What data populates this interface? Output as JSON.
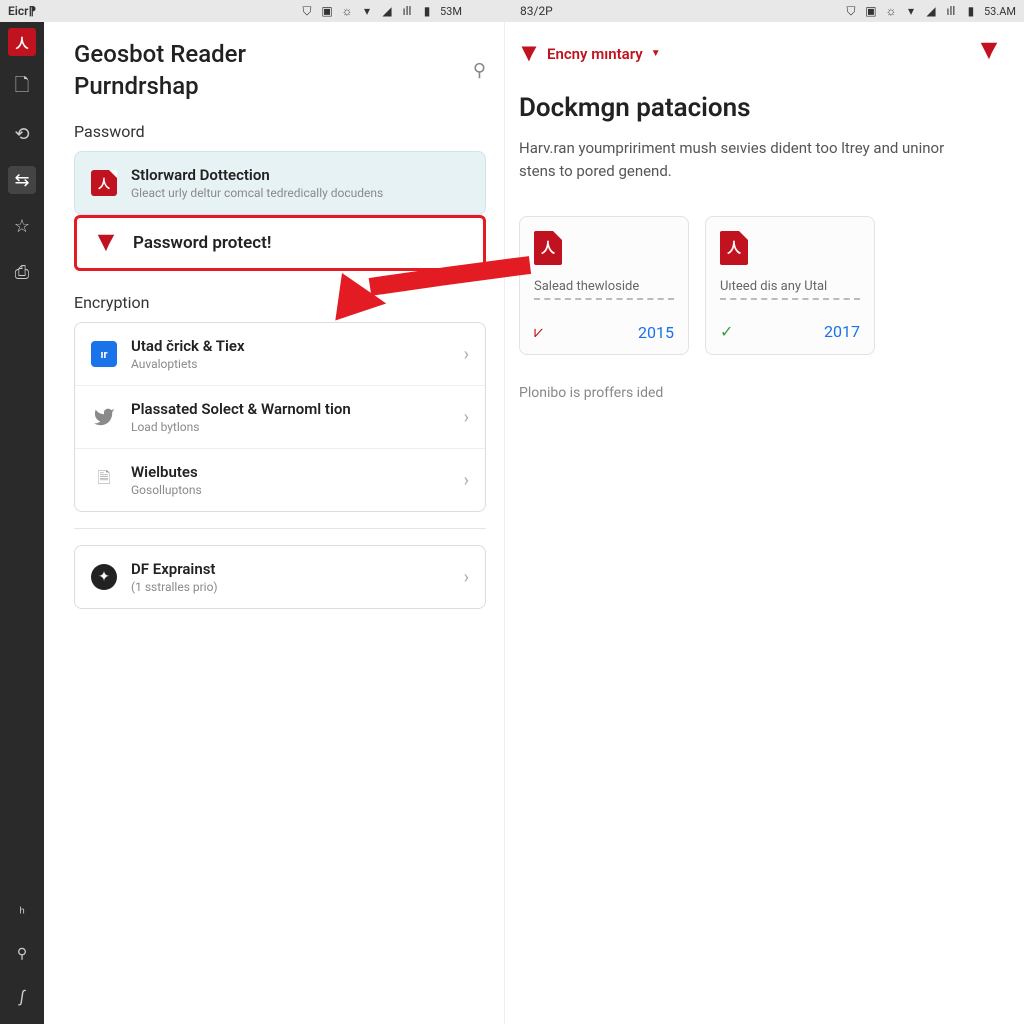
{
  "statusbar": {
    "left_label": "Eicr⁋",
    "time1": "53M",
    "time_mid": "83/2P",
    "time2": "53.AM"
  },
  "left": {
    "title": "Geosbot Reader",
    "subtitle": "Purndrshap",
    "section_password": "Password",
    "card1": {
      "title": "Stlorward Dottection",
      "sub": "Gleact urly deltur comcal tedredically docudens"
    },
    "highlight": {
      "title": "Password protect!"
    },
    "section_encryption": "Encryption",
    "enc1": {
      "title": "Utad črick & Tiex",
      "sub": "Auvaloptiets"
    },
    "enc2": {
      "title": "Plassated Solect & Warnoml tion",
      "sub": "Load bytlons"
    },
    "enc3": {
      "title": "Wielbutes",
      "sub": "Gosolluptons"
    },
    "extra": {
      "title": "DF Exprainst",
      "sub": "(1 sstralles prio)"
    }
  },
  "right": {
    "brand": "Encny mıntary",
    "heading": "Dockmgn patacions",
    "body": "Harv.ran youmpririment mush seıvies dident too ltrey and uninor stens to pored genend.",
    "doc1": {
      "title": "Salead thewloside",
      "year": "2015"
    },
    "doc2": {
      "title": "Uıteed dis any Utal",
      "year": "2017"
    },
    "note": "Plonibo is proffers ided"
  }
}
